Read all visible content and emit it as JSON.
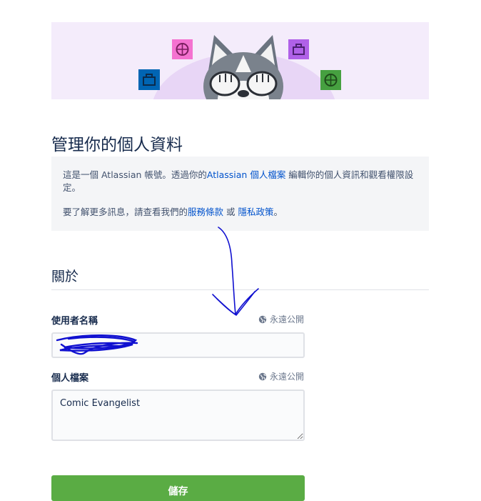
{
  "hero": {
    "icons": [
      "bag-icon",
      "basketball-icon",
      "bag-icon",
      "basketball-icon"
    ],
    "mascot": "husky-covering-eyes",
    "colors": {
      "background": "#f4ecfb",
      "blue": "#0065b3",
      "pink": "#f472d0",
      "purple": "#b061e8",
      "green": "#46a040"
    }
  },
  "page_title": "管理你的個人資料",
  "info": {
    "line1_before": "這是一個 Atlassian 帳號。透過你的",
    "line1_link": "Atlassian 個人檔案",
    "line1_after": " 編輯你的個人資訊和觀看權限設定。",
    "line2_before": "要了解更多訊息，請查看我們的",
    "line2_link1": "服務條款",
    "line2_between": " 或 ",
    "line2_link2": "隱私政策",
    "line2_after": "。"
  },
  "about": {
    "title": "關於",
    "username": {
      "label": "使用者名稱",
      "visibility": "永遠公開",
      "visibility_icon": "globe-icon",
      "value": ""
    },
    "profile": {
      "label": "個人檔案",
      "visibility": "永遠公開",
      "visibility_icon": "globe-icon",
      "value": "Comic Evangelist"
    }
  },
  "save_label": "儲存",
  "colors": {
    "accent_link": "#0052cc",
    "save_button": "#5aac44",
    "annotation_ink": "#1010d0"
  }
}
